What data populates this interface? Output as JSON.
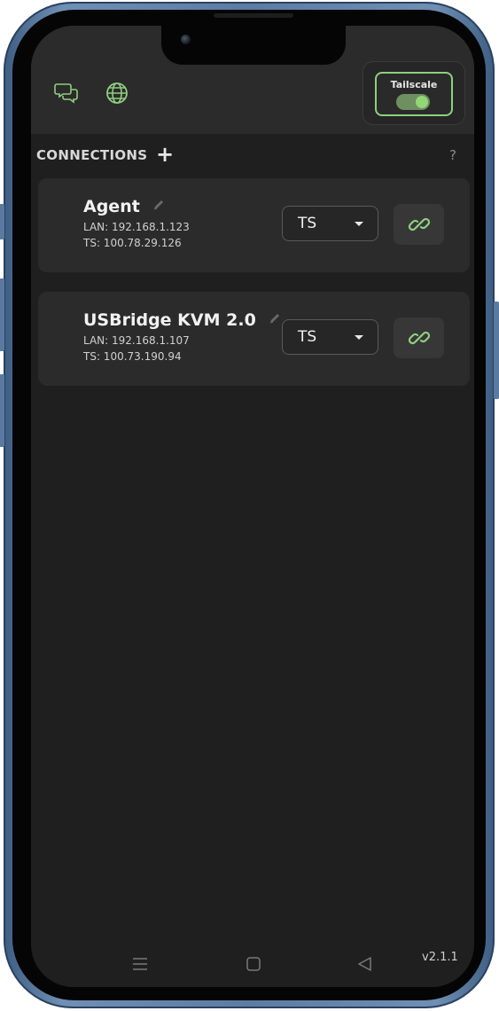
{
  "header": {
    "tailscale_label": "Tailscale",
    "tailscale_enabled": true
  },
  "connections": {
    "title": "CONNECTIONS",
    "add_label": "+",
    "help_label": "?",
    "items": [
      {
        "name": "Agent",
        "lan": "LAN: 192.168.1.123",
        "ts": "TS: 100.78.29.126",
        "mode": "TS"
      },
      {
        "name": "USBridge KVM 2.0",
        "lan": "LAN: 192.168.1.107",
        "ts": "TS: 100.73.190.94",
        "mode": "TS"
      }
    ]
  },
  "footer": {
    "version": "v2.1.1"
  },
  "icons": {
    "chat": "chat-icon",
    "globe": "globe-icon",
    "edit": "pencil-icon",
    "link": "link-icon",
    "menu": "menu-icon",
    "home": "home-icon",
    "back": "back-icon"
  },
  "colors": {
    "accent": "#8fce80",
    "background": "#1f1f1f",
    "card": "#2b2b2b"
  }
}
